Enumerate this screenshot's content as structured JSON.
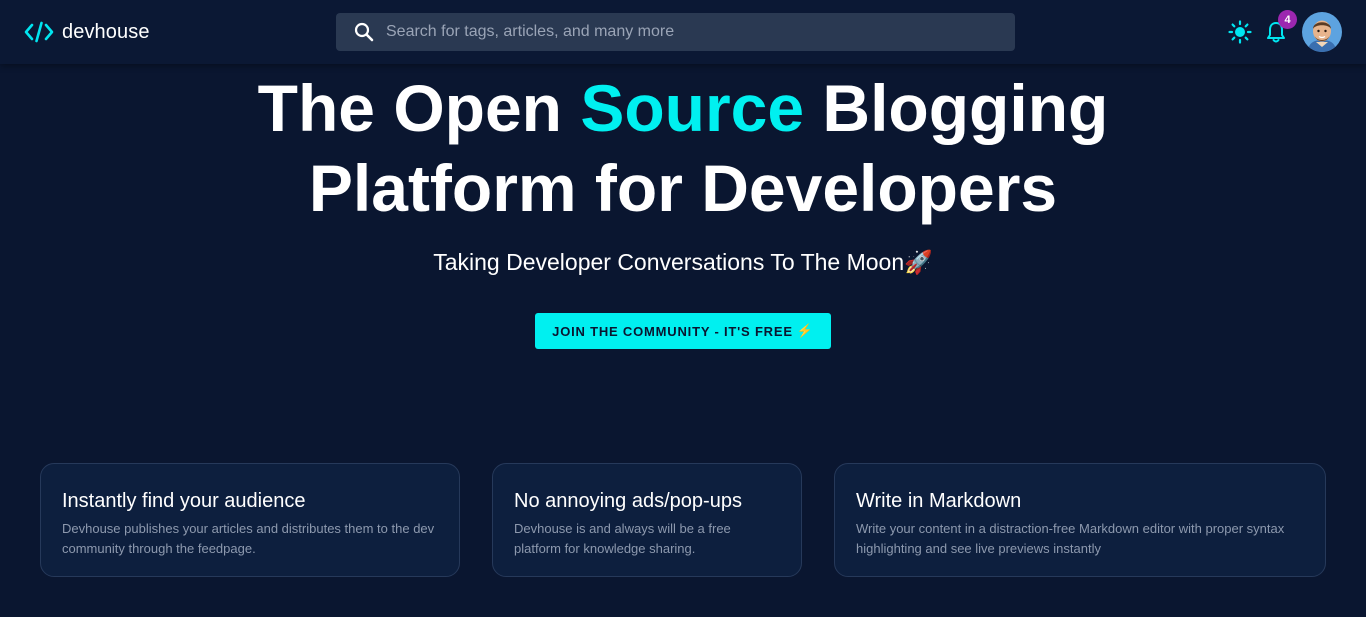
{
  "nav": {
    "brand_name": "devhouse",
    "search_placeholder": "Search for tags, articles, and many more",
    "notification_count": "4"
  },
  "hero": {
    "title_part1": "The Open ",
    "title_accent": "Source",
    "title_part2": " Blogging",
    "title_line2": "Platform for Developers",
    "tagline": "Taking Developer Conversations To The Moon",
    "tagline_emoji": "🚀",
    "cta_label": "JOIN THE COMMUNITY - IT'S FREE",
    "cta_emoji": "⚡"
  },
  "features": [
    {
      "title": "Instantly find your audience",
      "description": "Devhouse publishes your articles and distributes them to the dev community through the feedpage."
    },
    {
      "title": "No annoying ads/pop-ups",
      "description": "Devhouse is and always will be a free platform for knowledge sharing."
    },
    {
      "title": "Write in Markdown",
      "description": "Write your content in a distraction-free Markdown editor with proper syntax highlighting and see live previews instantly"
    }
  ],
  "colors": {
    "background": "#0a1630",
    "navbar": "#0b1834",
    "accent": "#00f0f0",
    "badge": "#9c27b0",
    "card": "#0d1f3e"
  },
  "icons": {
    "brand": "code-icon",
    "search": "search-icon",
    "theme": "sun-icon",
    "notifications": "bell-icon",
    "cta": "lightning-icon",
    "tagline": "rocket-icon"
  }
}
